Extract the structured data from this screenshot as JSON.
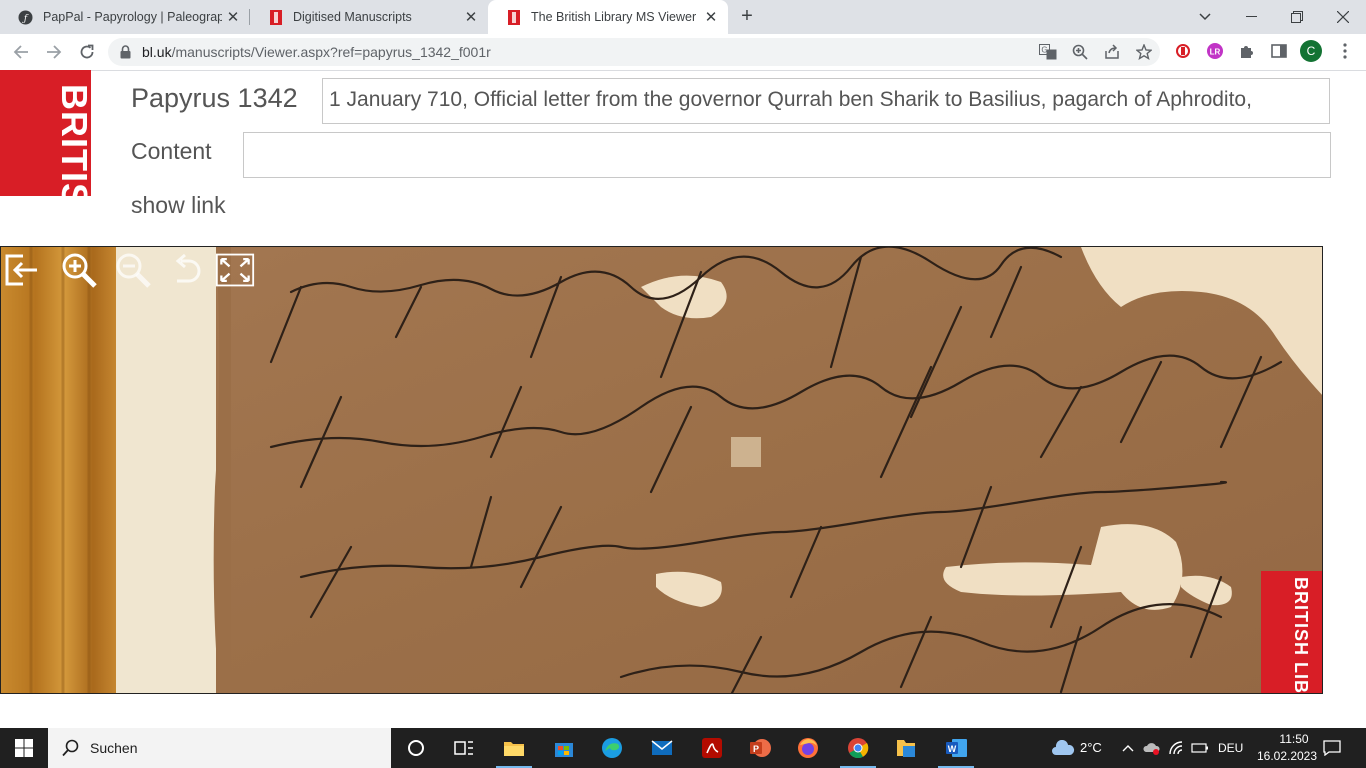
{
  "browser": {
    "tabs": [
      {
        "title": "PapPal - Papyrology | Paleograph",
        "active": false
      },
      {
        "title": "Digitised Manuscripts",
        "active": false
      },
      {
        "title": "The British Library MS Viewer",
        "active": true
      }
    ],
    "new_tab": "+",
    "url_domain": "bl.uk",
    "url_path": "/manuscripts/Viewer.aspx?ref=papyrus_1342_f001r",
    "profile_initial": "C"
  },
  "page": {
    "logo_text": "BRITISH LIBRARY",
    "title": "Papyrus 1342",
    "description": "1 January 710, Official letter from the governor Qurrah ben Sharik to Basilius, pagarch of Aphrodito,",
    "content_label": "Content",
    "content_value": "",
    "show_link": "show link",
    "viewer_logo_text": "BRITISH LIBRARY"
  },
  "viewer_tools": [
    {
      "name": "exit-viewer-icon"
    },
    {
      "name": "zoom-in-icon"
    },
    {
      "name": "zoom-out-icon"
    },
    {
      "name": "rotate-icon"
    },
    {
      "name": "fullscreen-icon"
    }
  ],
  "taskbar": {
    "search_label": "Suchen",
    "weather": "2°C",
    "language": "DEU",
    "time": "11:50",
    "date": "16.02.2023"
  },
  "colors": {
    "bl_red": "#d81e26",
    "papyrus": "#9c7047",
    "ink": "#2e2118",
    "gap": "#f0dfc3"
  }
}
